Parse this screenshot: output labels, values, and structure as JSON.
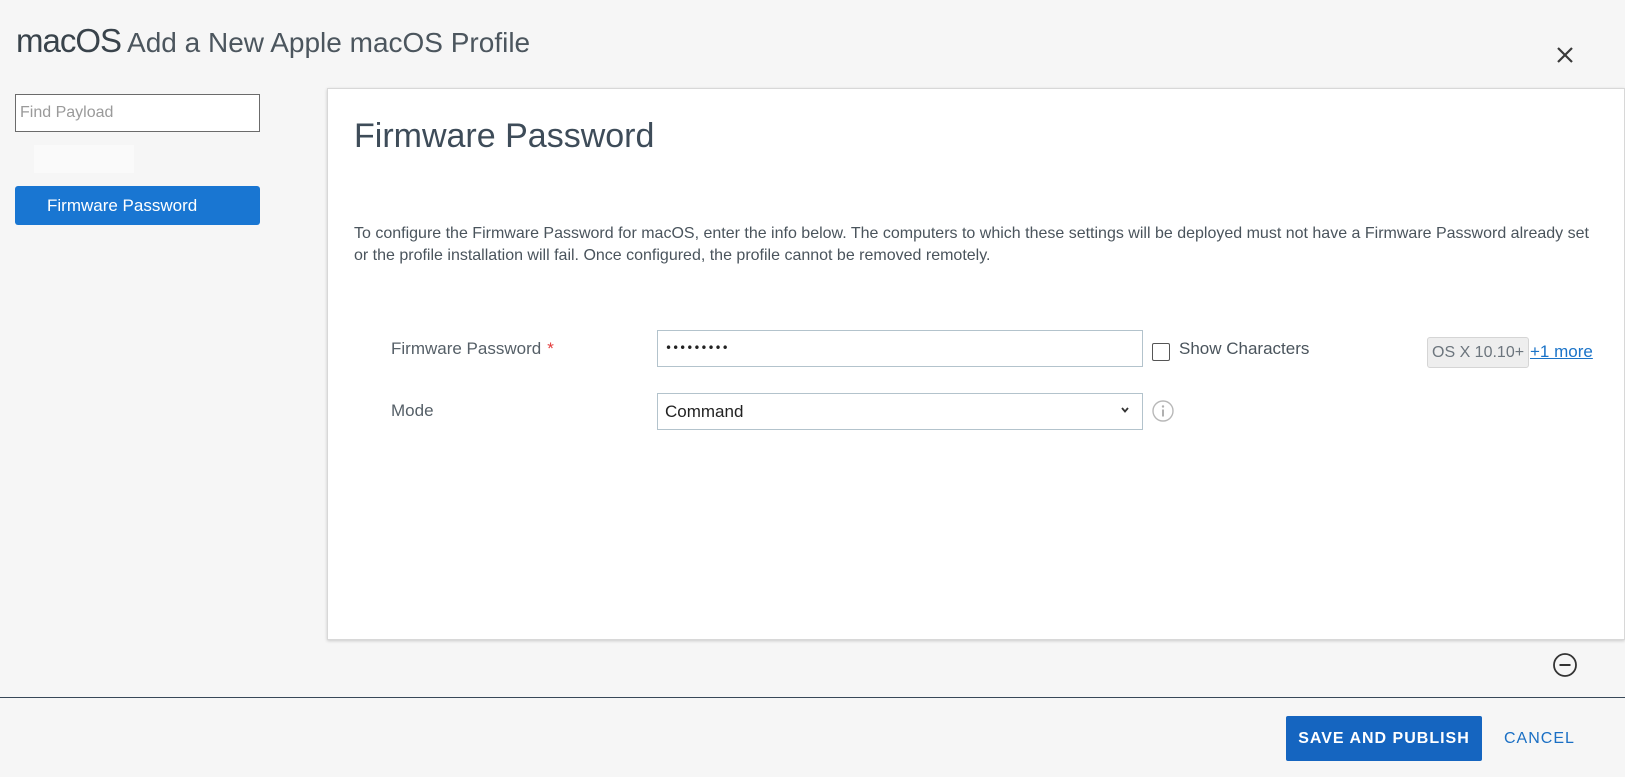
{
  "header": {
    "os_label": "macOS",
    "title": "Add a New Apple macOS Profile"
  },
  "sidebar": {
    "search_placeholder": "Find Payload",
    "items": [
      {
        "label": "Firmware Password",
        "selected": true
      }
    ]
  },
  "panel": {
    "title": "Firmware Password",
    "description": "To configure the Firmware Password for macOS, enter the info below. The computers to which these settings will be deployed must not have a Firmware Password already set or the profile installation will fail. Once configured, the profile cannot be removed remotely.",
    "fields": {
      "password": {
        "label": "Firmware Password",
        "required_marker": "*",
        "masked_value": "•••••••••",
        "show_characters_label": "Show Characters",
        "show_characters_checked": false,
        "os_badge": "OS X 10.10+",
        "more_link": "+1 more"
      },
      "mode": {
        "label": "Mode",
        "selected": "Command"
      }
    }
  },
  "footer": {
    "save_label": "SAVE AND PUBLISH",
    "cancel_label": "CANCEL"
  },
  "colors": {
    "primary": "#1976d2",
    "button": "#1565c0",
    "required": "#e23b3b",
    "link": "#1a73c8"
  },
  "icons": {
    "close": "close-icon",
    "chevron": "chevron-down-icon",
    "info": "info-icon",
    "collapse": "minus-circle-icon"
  }
}
